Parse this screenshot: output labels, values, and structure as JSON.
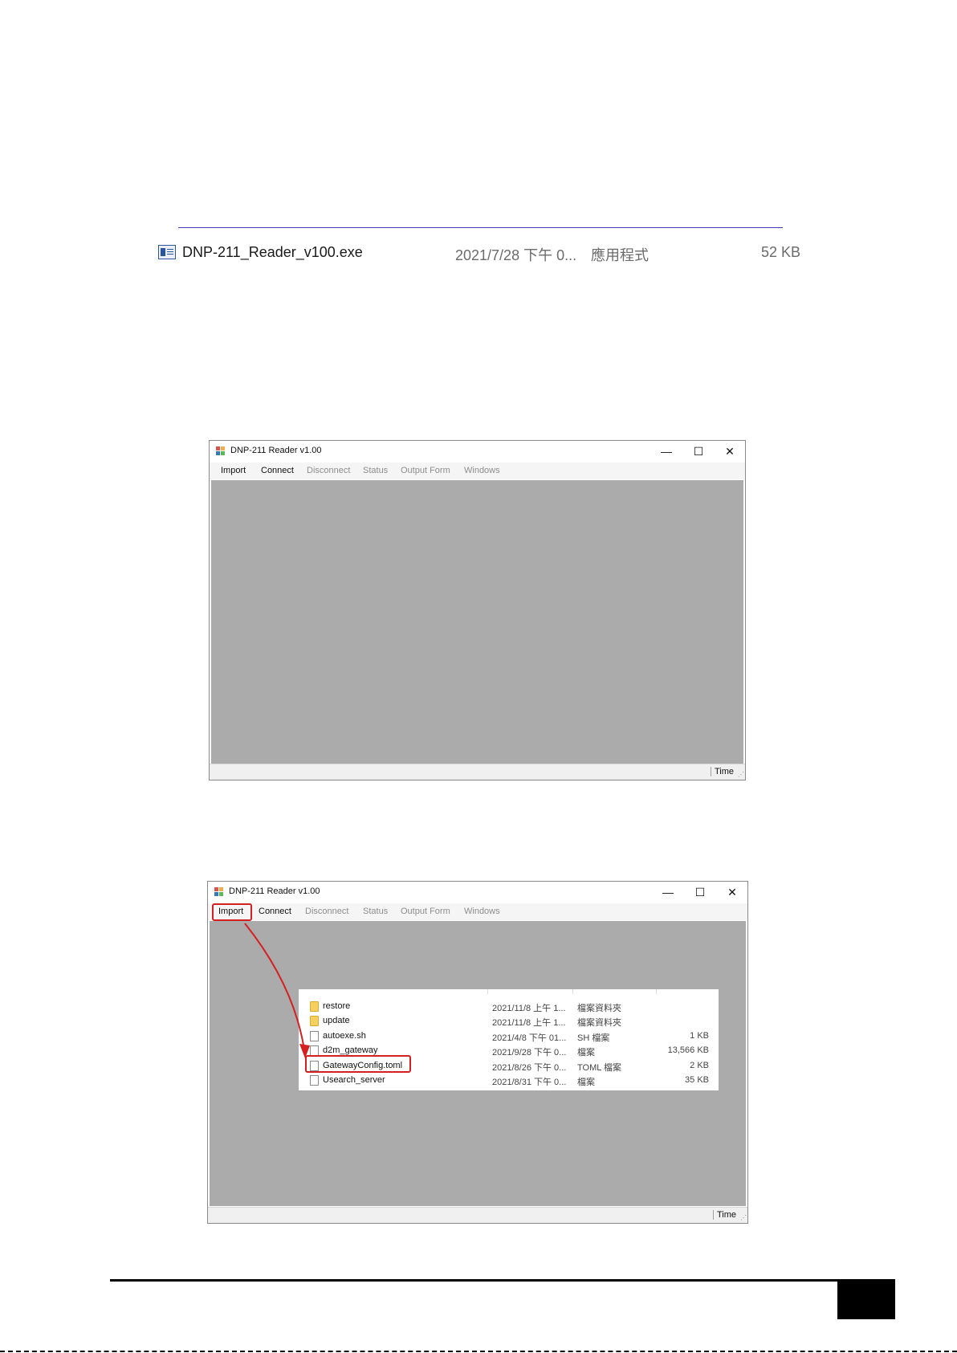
{
  "file_listing": {
    "name": "DNP-211_Reader_v100.exe",
    "date": "2021/7/28 下午 0...",
    "type": "應用程式",
    "size": "52 KB"
  },
  "app_window": {
    "title": "DNP-211 Reader v1.00",
    "menu": [
      "Import",
      "Connect",
      "Disconnect",
      "Status",
      "Output Form",
      "Windows"
    ],
    "status_time": "Time",
    "minimize_glyph": "—",
    "maximize_glyph": "☐",
    "close_glyph": "✕"
  },
  "file_dialog": {
    "rows": [
      {
        "name": "restore",
        "date": "2021/11/8 上午 1...",
        "type": "檔案資料夾",
        "size": "",
        "kind": "folder"
      },
      {
        "name": "update",
        "date": "2021/11/8 上午 1...",
        "type": "檔案資料夾",
        "size": "",
        "kind": "folder"
      },
      {
        "name": "autoexe.sh",
        "date": "2021/4/8 下午 01...",
        "type": "SH 檔案",
        "size": "1 KB",
        "kind": "file"
      },
      {
        "name": "d2m_gateway",
        "date": "2021/9/28 下午 0...",
        "type": "檔案",
        "size": "13,566 KB",
        "kind": "file"
      },
      {
        "name": "GatewayConfig.toml",
        "date": "2021/8/26 下午 0...",
        "type": "TOML 檔案",
        "size": "2 KB",
        "kind": "file"
      },
      {
        "name": "Usearch_server",
        "date": "2021/8/31 下午 0...",
        "type": "檔案",
        "size": "35 KB",
        "kind": "file"
      }
    ],
    "highlighted": "GatewayConfig.toml"
  },
  "colors": {
    "highlight": "#d42020",
    "workspace": "#ababab",
    "link_line": "#3b3bb8"
  }
}
